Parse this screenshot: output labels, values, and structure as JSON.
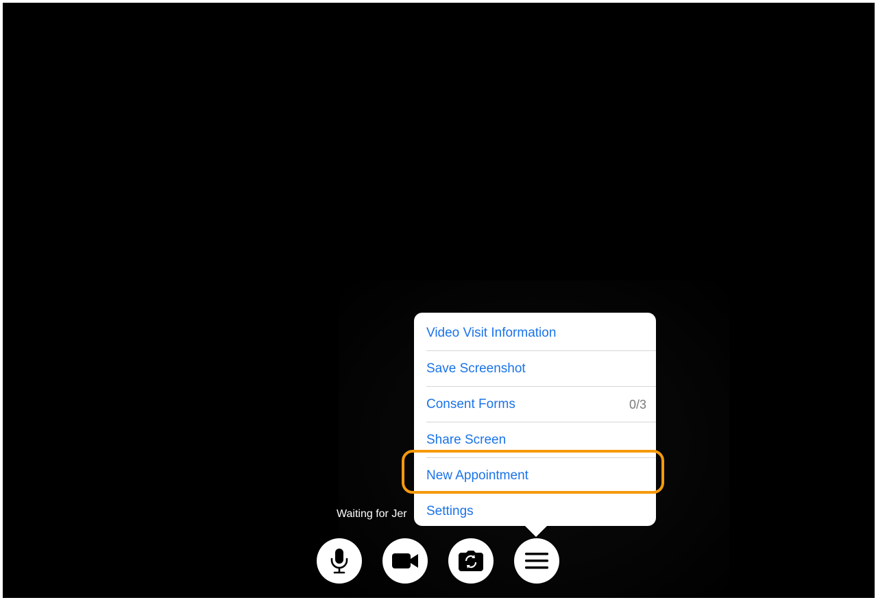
{
  "status": {
    "waiting_text": "Waiting for Jer"
  },
  "menu": {
    "items": [
      {
        "label": "Video Visit Information",
        "count": ""
      },
      {
        "label": "Save Screenshot",
        "count": ""
      },
      {
        "label": "Consent Forms",
        "count": "0/3"
      },
      {
        "label": "Share Screen",
        "count": ""
      },
      {
        "label": "New Appointment",
        "count": ""
      },
      {
        "label": "Settings",
        "count": ""
      }
    ],
    "highlighted_item": "New Appointment"
  },
  "controls": [
    {
      "name": "microphone",
      "icon": "microphone-icon"
    },
    {
      "name": "camera",
      "icon": "video-camera-icon"
    },
    {
      "name": "flip-camera",
      "icon": "camera-switch-icon"
    },
    {
      "name": "menu",
      "icon": "hamburger-menu-icon"
    }
  ],
  "colors": {
    "background": "#000000",
    "menu_text": "#1a73e8",
    "highlight": "#f59a0b",
    "count_text": "#7a7a7a"
  }
}
